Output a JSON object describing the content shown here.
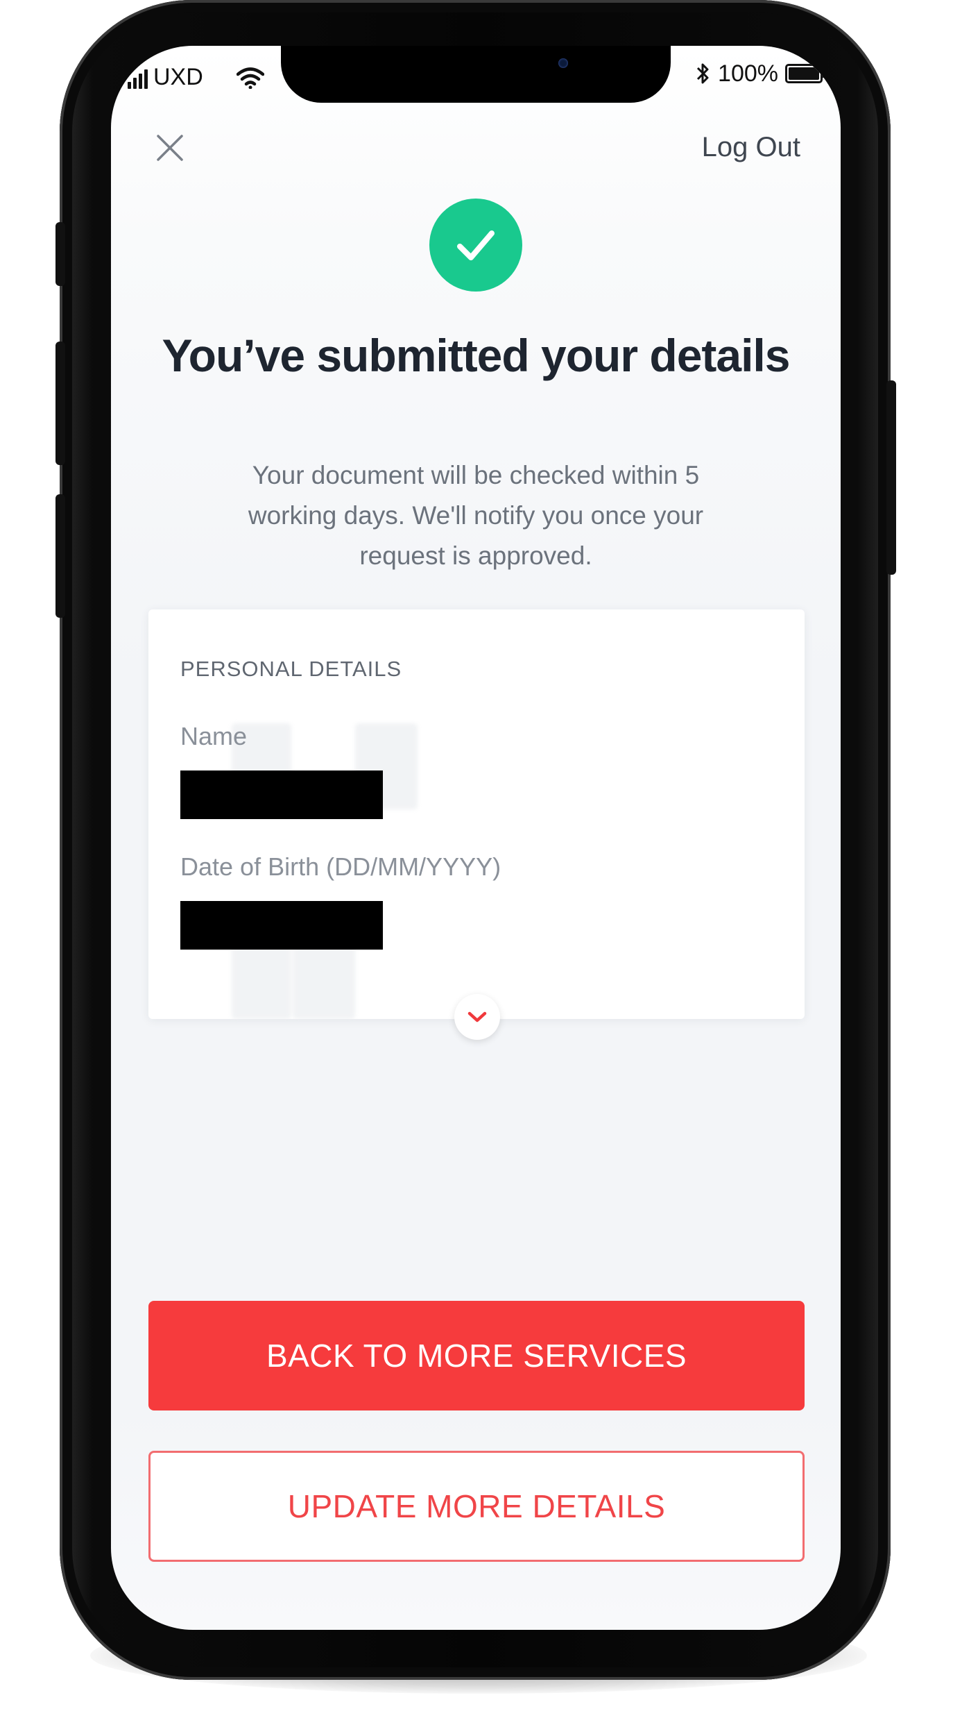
{
  "status_bar": {
    "carrier": "UXD",
    "battery": "100%",
    "battery_level": 1.0
  },
  "header": {
    "close_icon": "close-icon",
    "logout_label": "Log Out"
  },
  "success": {
    "icon": "check-icon",
    "icon_color": "#19c98e",
    "title": "You’ve submitted your details",
    "message": "Your document will be checked within 5 working days. We'll notify you once your request is approved."
  },
  "personal_details": {
    "heading": "PERSONAL DETAILS",
    "fields": [
      {
        "label": "Name",
        "value_redacted": true
      },
      {
        "label": "Date of Birth (DD/MM/YYYY)",
        "value_redacted": true
      }
    ],
    "expand_icon": "chevron-down-icon"
  },
  "actions": {
    "primary_label": "BACK TO MORE SERVICES",
    "secondary_label": "UPDATE MORE DETAILS",
    "accent_color": "#f63b3d"
  }
}
